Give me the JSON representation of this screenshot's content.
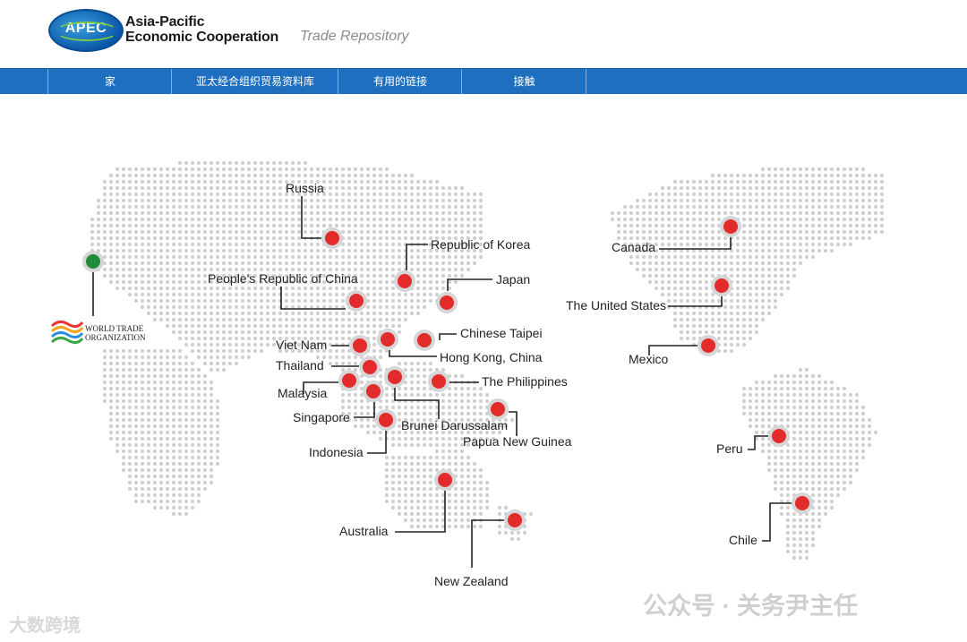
{
  "header": {
    "logo_text": "APEC",
    "org_line1": "Asia-Pacific",
    "org_line2": "Economic Cooperation",
    "repository": "Trade Repository"
  },
  "nav": {
    "items": [
      "家",
      "亚太经合组织贸易资料库",
      "有用的链接",
      "接触"
    ]
  },
  "map": {
    "wto_label_line1": "WORLD TRADE",
    "wto_label_line2": "ORGANIZATION",
    "economies": [
      "Russia",
      "Republic of Korea",
      "Japan",
      "People's Republic of China",
      "Chinese Taipei",
      "Viet Nam",
      "Hong Kong, China",
      "Thailand",
      "The Philippines",
      "Malaysia",
      "Singapore",
      "Brunei Darussalam",
      "Papua New Guinea",
      "Indonesia",
      "Australia",
      "New Zealand",
      "Canada",
      "The United States",
      "Mexico",
      "Peru",
      "Chile"
    ],
    "marker_colors": {
      "economy": "#e32b2b",
      "wto": "#1e8a3a",
      "halo": "#d6d6d6"
    }
  },
  "watermark": {
    "line1": "公众号 · 关务尹主任",
    "line2": "大数跨境"
  }
}
